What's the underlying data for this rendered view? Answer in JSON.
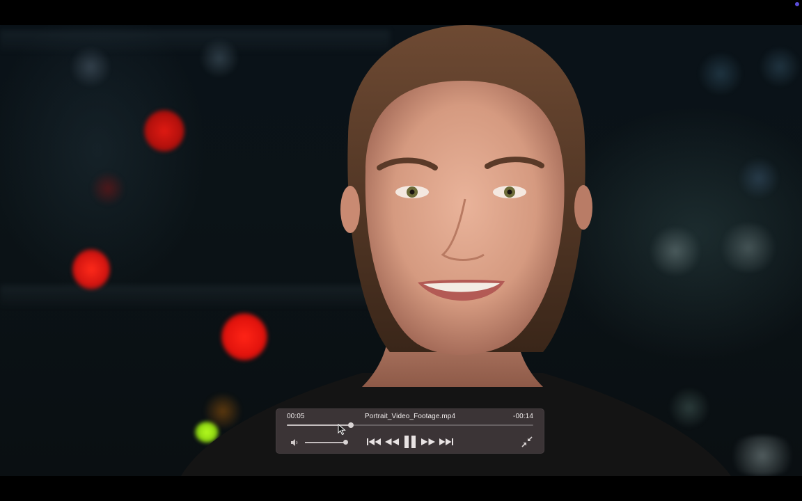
{
  "window": {
    "status_dot_color": "#5b4dd8"
  },
  "player": {
    "file_name": "Portrait_Video_Footage.mp4",
    "time_current": "00:05",
    "time_remaining": "-00:14",
    "playback_progress": 0.26,
    "volume_level": 1.0,
    "state": "playing"
  },
  "controls": {
    "volume_icon": "speaker-icon",
    "skip_back_icon": "skip-to-start-icon",
    "rewind_icon": "rewind-icon",
    "pause_icon": "pause-icon",
    "fast_forward_icon": "fast-forward-icon",
    "skip_forward_icon": "skip-to-end-icon",
    "exit_fullscreen_icon": "exit-fullscreen-icon"
  },
  "colors": {
    "controller_bg": "rgba(70,62,64,0.78)",
    "control_text": "#f2eeee",
    "bokeh_red": "#ff1a10"
  }
}
